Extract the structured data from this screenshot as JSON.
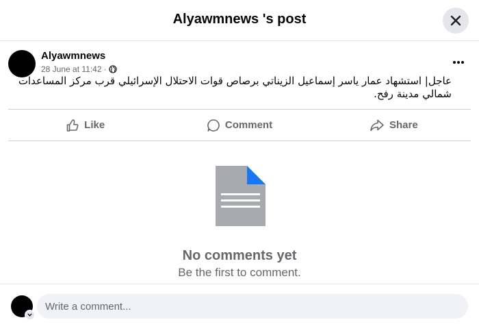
{
  "header": {
    "title": "Alyawmnews 's post",
    "close_icon": "close-icon"
  },
  "post": {
    "author": "Alyawmnews",
    "date": "28 June at 11:42",
    "separator": "·",
    "privacy_icon": "globe-icon",
    "more_icon": "more-horizontal-icon",
    "text": "عاجل| استشهاد عمار ياسر إسماعيل الزيناتي برصاص قوات الاحتلال الإسرائيلي قرب مركز المساعدات شمالي مدينة رفح."
  },
  "actions": [
    {
      "label": "Like",
      "icon": "thumbs-up-icon"
    },
    {
      "label": "Comment",
      "icon": "comment-bubble-icon"
    },
    {
      "label": "Share",
      "icon": "share-arrow-icon"
    }
  ],
  "comments": {
    "empty_icon": "document-icon",
    "empty_title": "No comments yet",
    "empty_subtitle": "Be the first to comment."
  },
  "composer": {
    "placeholder": "Write a comment..."
  },
  "colors": {
    "primary_text": "#050505",
    "secondary_text": "#65676b",
    "divider": "#ced0d4",
    "input_bg": "#f0f2f5",
    "doc_gray": "#a7aaaf",
    "doc_corner": "#1877f2"
  }
}
